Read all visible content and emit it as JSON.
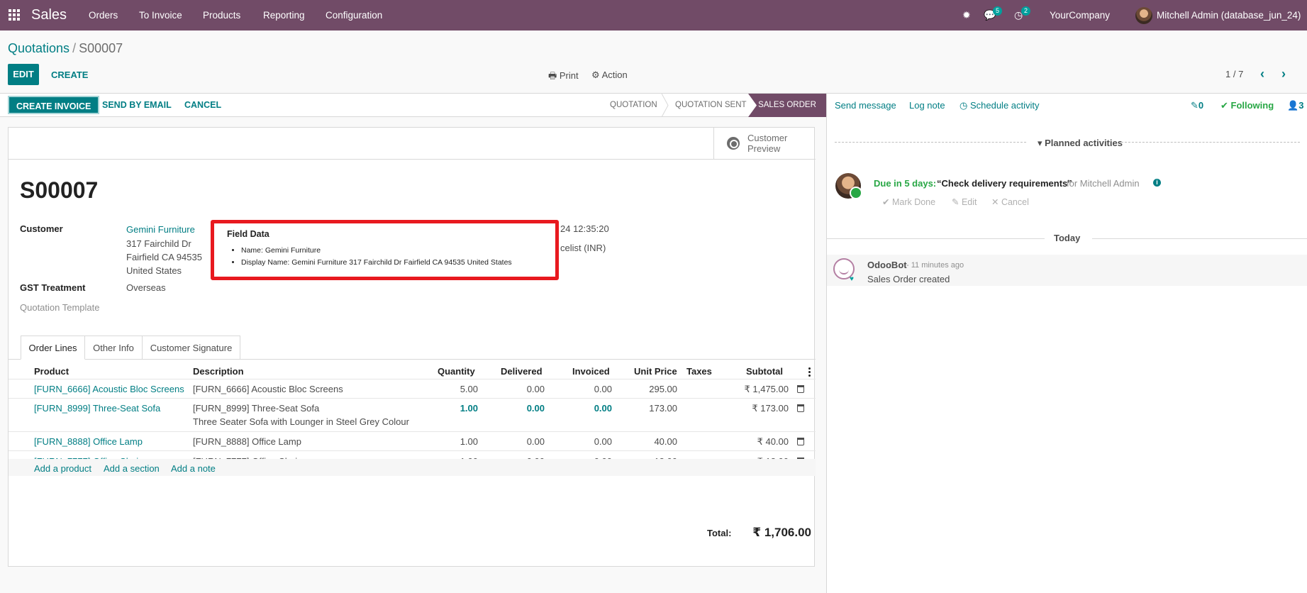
{
  "navbar": {
    "app_name": "Sales",
    "menus": [
      "Orders",
      "To Invoice",
      "Products",
      "Reporting",
      "Configuration"
    ],
    "messages_count": "5",
    "activities_count": "2",
    "company": "YourCompany",
    "user": "Mitchell Admin (database_jun_24)"
  },
  "breadcrumb": {
    "parent": "Quotations",
    "current": "S00007"
  },
  "control_panel": {
    "edit": "EDIT",
    "create": "CREATE",
    "print": "Print",
    "action": "Action",
    "pager": "1 / 7"
  },
  "statusbar": {
    "create_invoice": "CREATE INVOICE",
    "send_by_email": "SEND BY EMAIL",
    "cancel": "CANCEL",
    "stages": [
      "QUOTATION",
      "QUOTATION SENT",
      "SALES ORDER"
    ],
    "active_stage": "SALES ORDER"
  },
  "form": {
    "customer_preview": "Customer Preview",
    "name": "S00007",
    "customer_label": "Customer",
    "customer_name": "Gemini Furniture",
    "address_line1": "317 Fairchild Dr",
    "address_line2": "Fairfield CA 94535",
    "address_line3": "United States",
    "gst_label": "GST Treatment",
    "gst_value": "Overseas",
    "template_label": "Quotation Template",
    "date_fragment": "24 12:35:20",
    "pricelist_fragment": "celist (INR)"
  },
  "tooltip": {
    "title": "Field Data",
    "items": [
      "Name: Gemini Furniture",
      "Display Name: Gemini Furniture 317 Fairchild Dr Fairfield CA 94535 United States"
    ]
  },
  "tabs": [
    "Order Lines",
    "Other Info",
    "Customer Signature"
  ],
  "order_lines": {
    "headers": [
      "Product",
      "Description",
      "Quantity",
      "Delivered",
      "Invoiced",
      "Unit Price",
      "Taxes",
      "Subtotal"
    ],
    "rows": [
      {
        "product": "[FURN_6666] Acoustic Bloc Screens",
        "description": "[FURN_6666] Acoustic Bloc Screens",
        "description2": "",
        "quantity": "5.00",
        "delivered": "0.00",
        "invoiced": "0.00",
        "unit_price": "295.00",
        "taxes": "",
        "subtotal": "₹ 1,475.00"
      },
      {
        "product": "[FURN_8999] Three-Seat Sofa",
        "description": "[FURN_8999] Three-Seat Sofa",
        "description2": "Three Seater Sofa with Lounger in Steel Grey Colour",
        "quantity": "1.00",
        "delivered": "0.00",
        "invoiced": "0.00",
        "unit_price": "173.00",
        "taxes": "",
        "subtotal": "₹ 173.00"
      },
      {
        "product": "[FURN_8888] Office Lamp",
        "description": "[FURN_8888] Office Lamp",
        "description2": "",
        "quantity": "1.00",
        "delivered": "0.00",
        "invoiced": "0.00",
        "unit_price": "40.00",
        "taxes": "",
        "subtotal": "₹ 40.00"
      },
      {
        "product": "[FURN_7777] Office Chair",
        "description": "[FURN_7777] Office Chair",
        "description2": "",
        "quantity": "1.00",
        "delivered": "0.00",
        "invoiced": "0.00",
        "unit_price": "18.00",
        "taxes": "",
        "subtotal": "₹ 18.00"
      }
    ],
    "add_product": "Add a product",
    "add_section": "Add a section",
    "add_note": "Add a note",
    "total_label": "Total:",
    "total_value": "₹ 1,706.00"
  },
  "chatter": {
    "send_message": "Send message",
    "log_note": "Log note",
    "schedule_activity": "Schedule activity",
    "attachments": "0",
    "following": "Following",
    "followers": "3",
    "planned_activities": "Planned activities",
    "activity": {
      "due": "Due in 5 days:",
      "summary": "“Check delivery requirements”",
      "for": "for Mitchell Admin",
      "mark_done": "Mark Done",
      "edit": "Edit",
      "cancel": "Cancel"
    },
    "today": "Today",
    "message": {
      "author": "OdooBot",
      "time": "- 11 minutes ago",
      "body": "Sales Order created"
    }
  },
  "colors": {
    "brand": "#714b67",
    "accent": "#017e84",
    "success": "#28a745",
    "highlight": "#e8191f"
  }
}
